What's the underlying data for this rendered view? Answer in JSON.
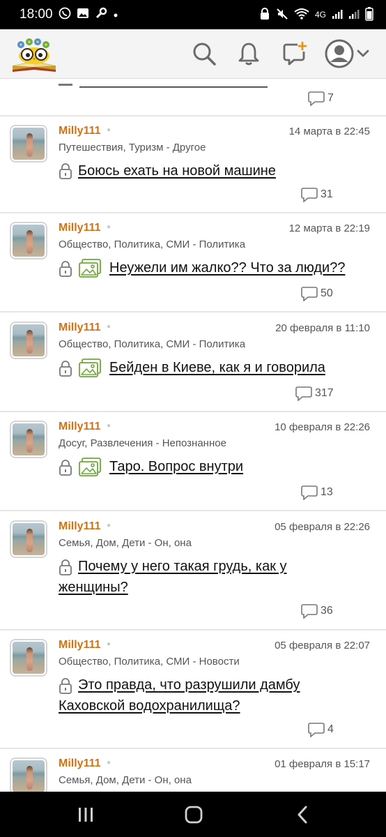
{
  "status_bar": {
    "time": "18:00",
    "network": "4G",
    "icons": [
      "viber-icon",
      "image-icon",
      "wrench-icon",
      "dot-icon",
      "lock-icon",
      "mute-icon",
      "wifi-icon",
      "signal-icon",
      "signal-icon",
      "battery-icon"
    ]
  },
  "header": {
    "logo": "owl-books-logo",
    "buttons": [
      "search-icon",
      "bell-icon",
      "add-post-icon",
      "profile-icon"
    ]
  },
  "partial_post": {
    "comments": "7"
  },
  "posts": [
    {
      "author": "Milly111",
      "date": "14 марта в 22:45",
      "category": "Путешествия, Туризм - Другое",
      "title": "Боюсь ехать на новой машине",
      "has_image": false,
      "comments": "31"
    },
    {
      "author": "Milly111",
      "date": "12 марта в 22:19",
      "category": "Общество, Политика, СМИ - Политика",
      "title": "Неужели им жалко?? Что за люди??",
      "has_image": true,
      "comments": "50"
    },
    {
      "author": "Milly111",
      "date": "20 февраля в 11:10",
      "category": "Общество, Политика, СМИ - Политика",
      "title": "Бейден в Киеве, как я и говорила",
      "has_image": true,
      "comments": "317"
    },
    {
      "author": "Milly111",
      "date": "10 февраля в 22:26",
      "category": "Досуг, Развлечения - Непознанное",
      "title": "Таро. Вопрос внутри",
      "has_image": true,
      "comments": "13"
    },
    {
      "author": "Milly111",
      "date": "05 февраля в 22:26",
      "category": "Семья, Дом, Дети - Он, она",
      "title_line1": "Почему у него такая грудь, как у",
      "title_line2": "женщины?",
      "has_image": false,
      "comments": "36"
    },
    {
      "author": "Milly111",
      "date": "05 февраля в 22:07",
      "category": "Общество, Политика, СМИ - Новости",
      "title_line1": "Это правда, что разрушили дамбу",
      "title_line2": "Каховской водохранилища?",
      "has_image": false,
      "comments": "4"
    },
    {
      "author": "Milly111",
      "date": "01 февраля в 15:17",
      "category": "Семья, Дом, Дети - Он, она"
    }
  ],
  "colors": {
    "author": "#d3720f",
    "icon": "#6a6a6a",
    "image_icon": "#6fa83a"
  },
  "nav": [
    "recent-apps-icon",
    "home-icon",
    "back-icon"
  ]
}
